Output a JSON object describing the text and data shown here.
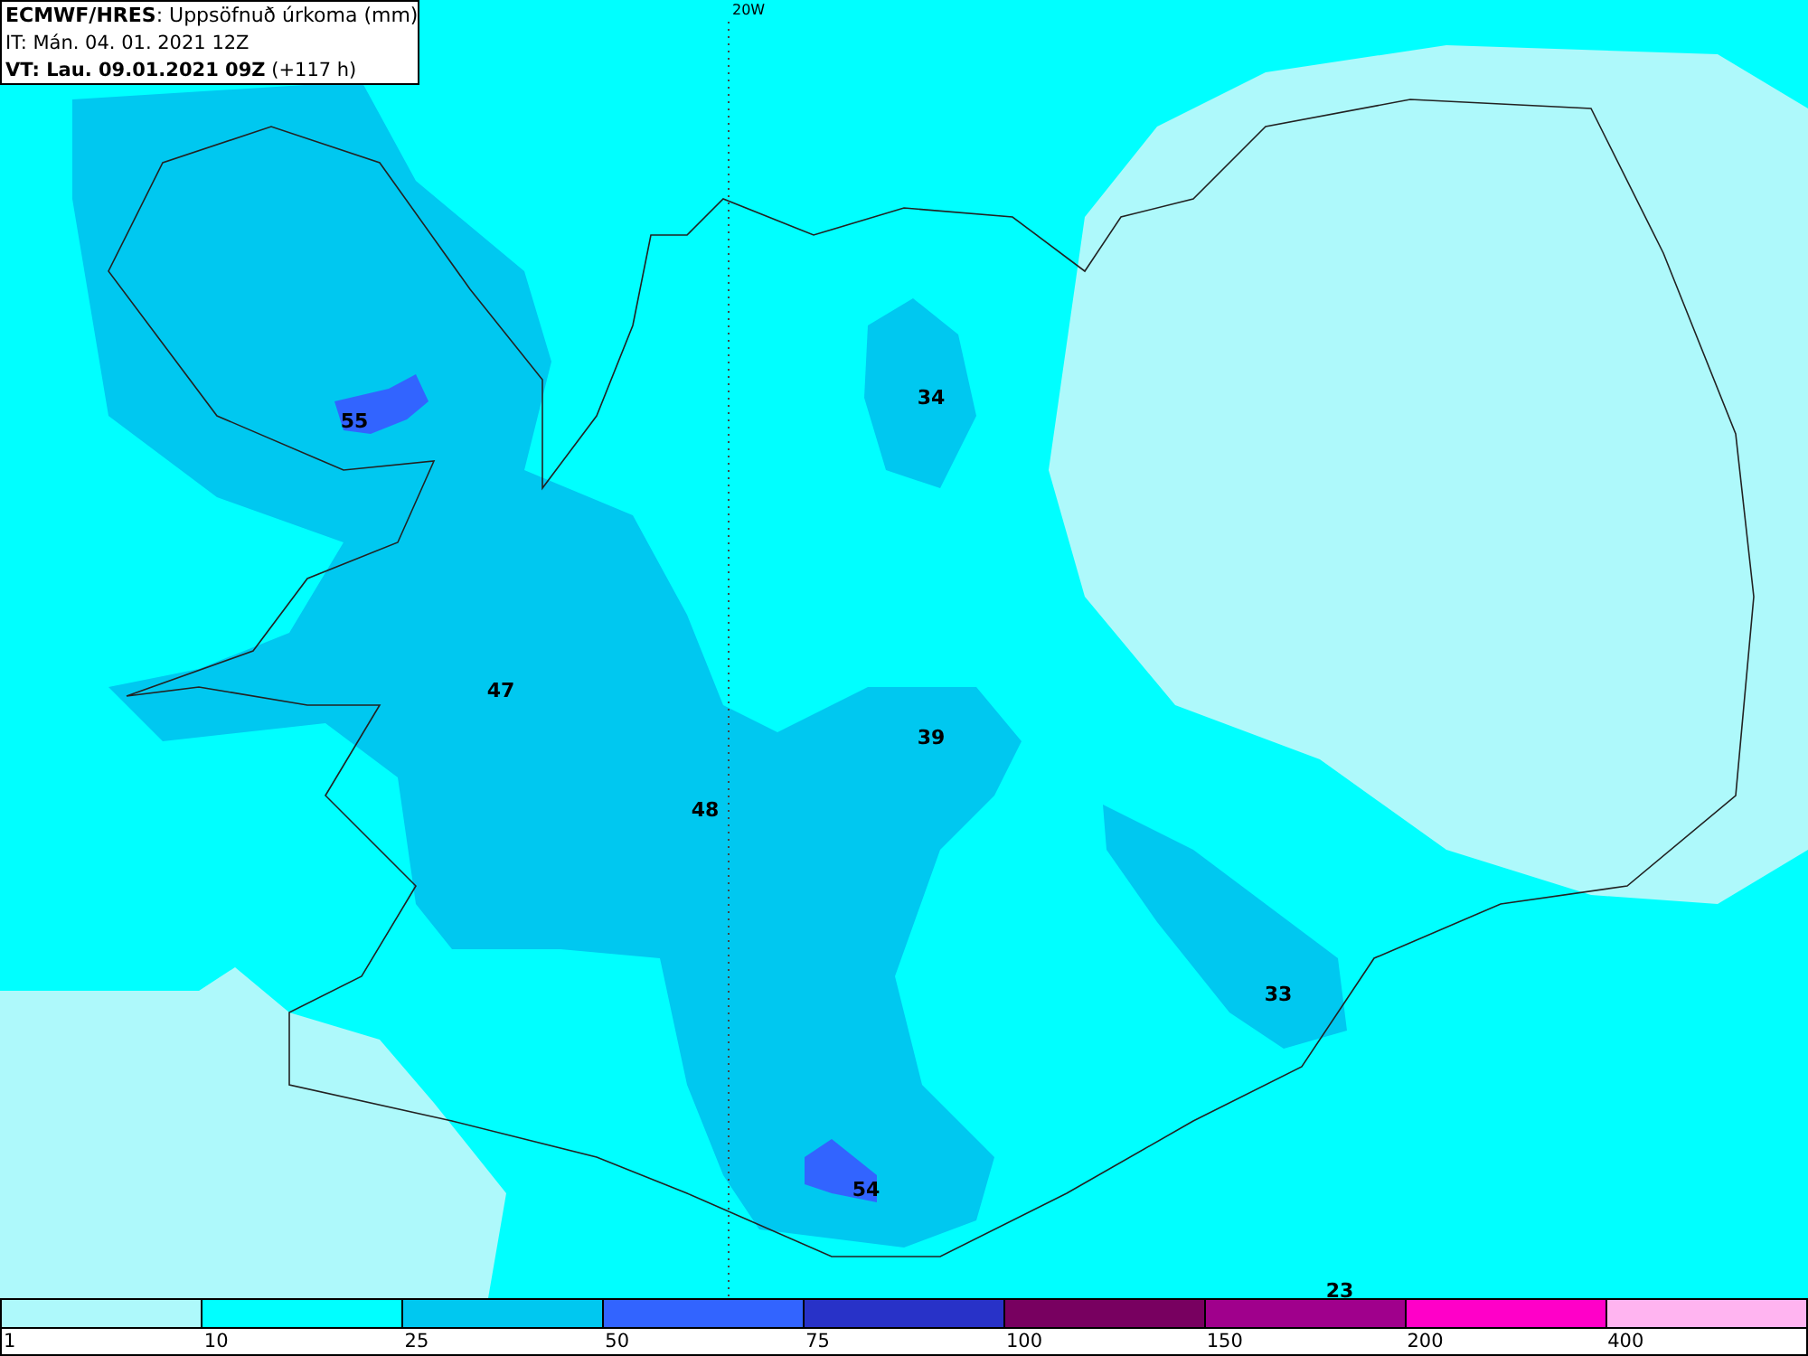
{
  "header": {
    "model": "ECMWF/HRES",
    "product": ": Uppsöfnuð úrkoma (mm)",
    "init_time": "IT: Mán. 04. 01. 2021 12Z",
    "valid_label": "VT: Lau. 09.01.2021 09Z",
    "lead": " (+117 h)"
  },
  "map": {
    "meridian_label": "20W",
    "values": [
      {
        "text": "55"
      },
      {
        "text": "34"
      },
      {
        "text": "47"
      },
      {
        "text": "39"
      },
      {
        "text": "48"
      },
      {
        "text": "33"
      },
      {
        "text": "54"
      },
      {
        "text": "23"
      }
    ]
  },
  "legend": {
    "bins": [
      {
        "color": "#aef9fb"
      },
      {
        "color": "#00ffff"
      },
      {
        "color": "#00c8f0"
      },
      {
        "color": "#3264ff"
      },
      {
        "color": "#2832c8"
      },
      {
        "color": "#780060"
      },
      {
        "color": "#a0008c"
      },
      {
        "color": "#ff00c8"
      },
      {
        "color": "#ffb4f0"
      }
    ],
    "ticks": [
      "1",
      "10",
      "25",
      "50",
      "75",
      "100",
      "150",
      "200",
      "400"
    ]
  }
}
